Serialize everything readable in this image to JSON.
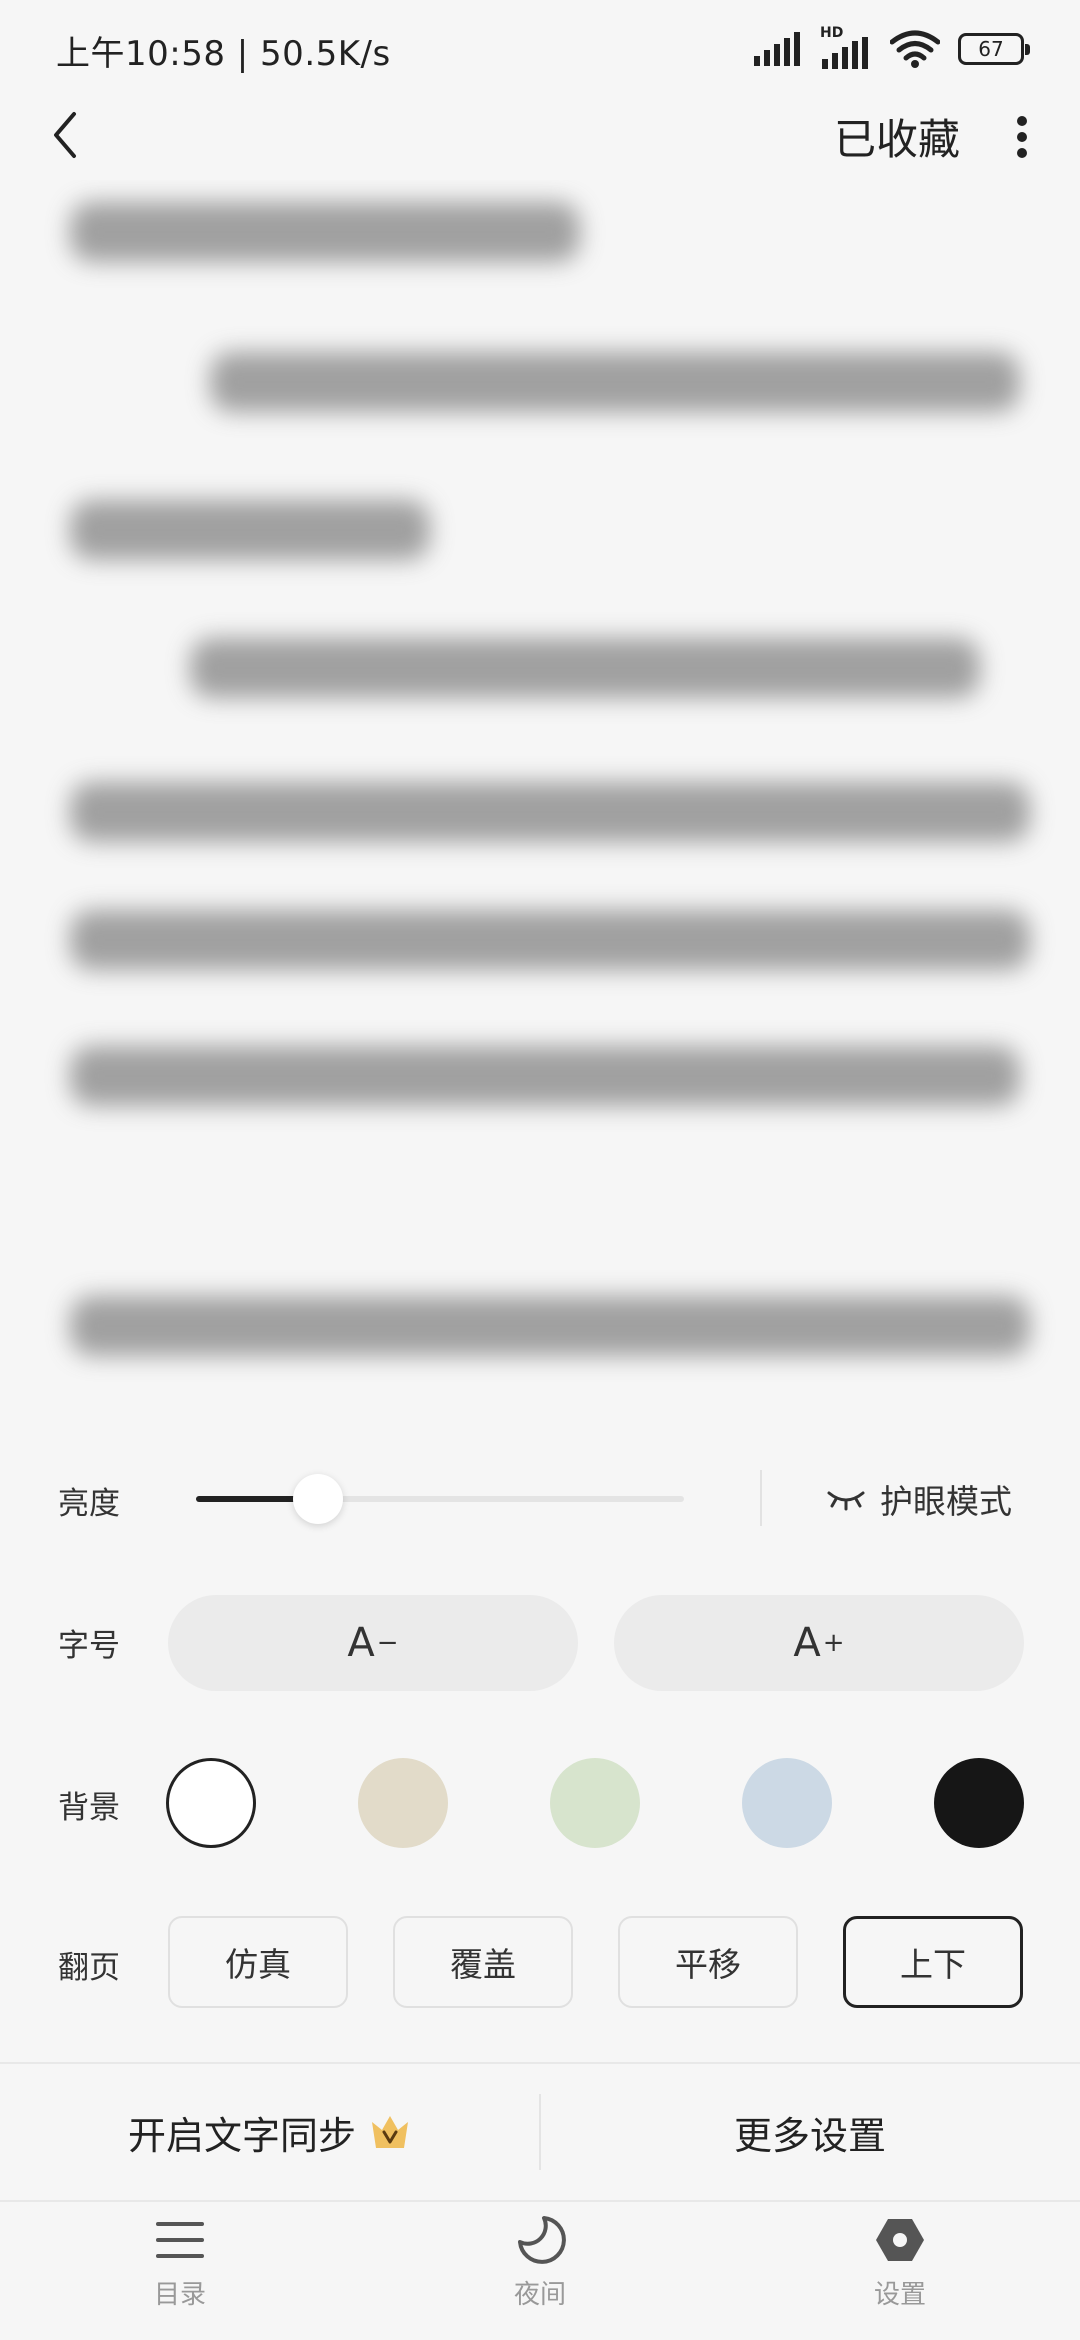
{
  "status_bar": {
    "time_speed": "上午10:58 | 50.5K/s",
    "battery": "67",
    "hd_badge": "HD"
  },
  "top_nav": {
    "collect_label": "已收藏"
  },
  "settings": {
    "brightness": {
      "label": "亮度",
      "level_fraction": 0.25,
      "eye_mode_label": "护眼模式"
    },
    "font_size": {
      "label": "字号",
      "decrease_label": "A",
      "decrease_sup": "−",
      "increase_label": "A",
      "increase_sup": "+"
    },
    "background": {
      "label": "背景",
      "swatches": [
        "#ffffff",
        "#e2dbc9",
        "#d7e4cd",
        "#ccd9e5",
        "#161616"
      ],
      "selected_index": 0
    },
    "page_flip": {
      "label": "翻页",
      "options": [
        "仿真",
        "覆盖",
        "平移",
        "上下"
      ],
      "selected": "上下"
    }
  },
  "actions": {
    "sync_text": "开启文字同步",
    "more_settings": "更多设置"
  },
  "tabs": [
    {
      "label": "目录",
      "icon": "list-icon"
    },
    {
      "label": "夜间",
      "icon": "moon-icon"
    },
    {
      "label": "设置",
      "icon": "settings-hex-icon"
    }
  ],
  "colors": {
    "background": "#f6f6f6",
    "text": "#222222",
    "muted": "#999999",
    "crown": "#f0c060"
  }
}
